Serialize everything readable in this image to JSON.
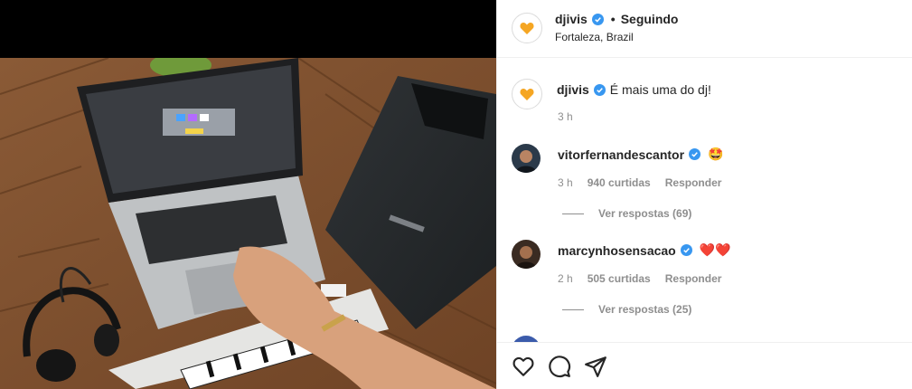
{
  "post": {
    "username": "djivis",
    "follow_status": "Seguindo",
    "location": "Fortaleza, Brazil",
    "caption": "É mais uma do dj!",
    "caption_time": "3 h"
  },
  "comments": [
    {
      "username": "vitorfernandescantor",
      "emoji": "🤩",
      "time": "3 h",
      "likes": "940 curtidas",
      "reply_label": "Responder",
      "view_replies": "Ver respostas (69)"
    },
    {
      "username": "marcynhosensacao",
      "emoji": "❤️❤️",
      "time": "2 h",
      "likes": "505 curtidas",
      "reply_label": "Responder",
      "view_replies": "Ver respostas (25)"
    }
  ],
  "colors": {
    "verified": "#3897f0",
    "brand_heart": "#f5a623",
    "muted": "#8e8e8e"
  },
  "icons": {
    "like": "heart-outline-icon",
    "comment": "comment-icon",
    "share": "paper-plane-icon"
  }
}
